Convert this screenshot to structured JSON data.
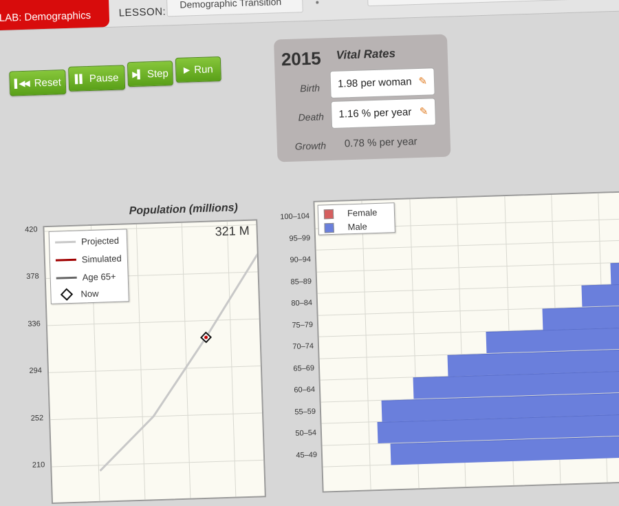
{
  "header": {
    "lab_tab": "LAB: Demographics",
    "lesson_label": "LESSON:",
    "lesson_value": "Demographic Transition"
  },
  "controls": {
    "reset": "Reset",
    "pause": "Pause",
    "step": "Step",
    "run": "Run"
  },
  "vital_rates": {
    "year": "2015",
    "title": "Vital Rates",
    "birth_label": "Birth",
    "birth_value": "1.98 per woman",
    "death_label": "Death",
    "death_value": "1.16 % per year",
    "growth_label": "Growth",
    "growth_value": "0.78 % per year"
  },
  "population_chart": {
    "title": "Population (millions)",
    "current": "321 M",
    "yticks": [
      "420",
      "378",
      "336",
      "294",
      "252",
      "210"
    ],
    "legend": [
      "Projected",
      "Simulated",
      "Age 65+",
      "Now"
    ]
  },
  "pyramid_chart": {
    "legend": [
      "Female",
      "Male"
    ],
    "age_groups": [
      "100–104",
      "95–99",
      "90–94",
      "85–89",
      "80–84",
      "75–79",
      "70–74",
      "65–69",
      "60–64",
      "55–59",
      "50–54",
      "45–49"
    ],
    "colors": {
      "female": "#d65f5f",
      "male": "#6a7fdc"
    }
  },
  "chart_data": [
    {
      "type": "line",
      "title": "Population (millions)",
      "ylim": [
        210,
        420
      ],
      "series": [
        {
          "name": "Projected",
          "x": [
            0,
            1,
            2,
            3
          ],
          "values": [
            205,
            252,
            321,
            395
          ]
        },
        {
          "name": "Now",
          "x": [
            2
          ],
          "values": [
            321
          ]
        }
      ]
    },
    {
      "type": "bar",
      "categories": [
        "100–104",
        "95–99",
        "90–94",
        "85–89",
        "80–84",
        "75–79",
        "70–74",
        "65–69",
        "60–64",
        "55–59",
        "50–54",
        "45–49"
      ],
      "series": [
        {
          "name": "Male",
          "values": [
            0,
            0,
            0.4,
            1.2,
            2.4,
            4.0,
            6.3,
            7.9,
            9.3,
            10.6,
            10.8,
            10.3
          ]
        }
      ]
    }
  ]
}
